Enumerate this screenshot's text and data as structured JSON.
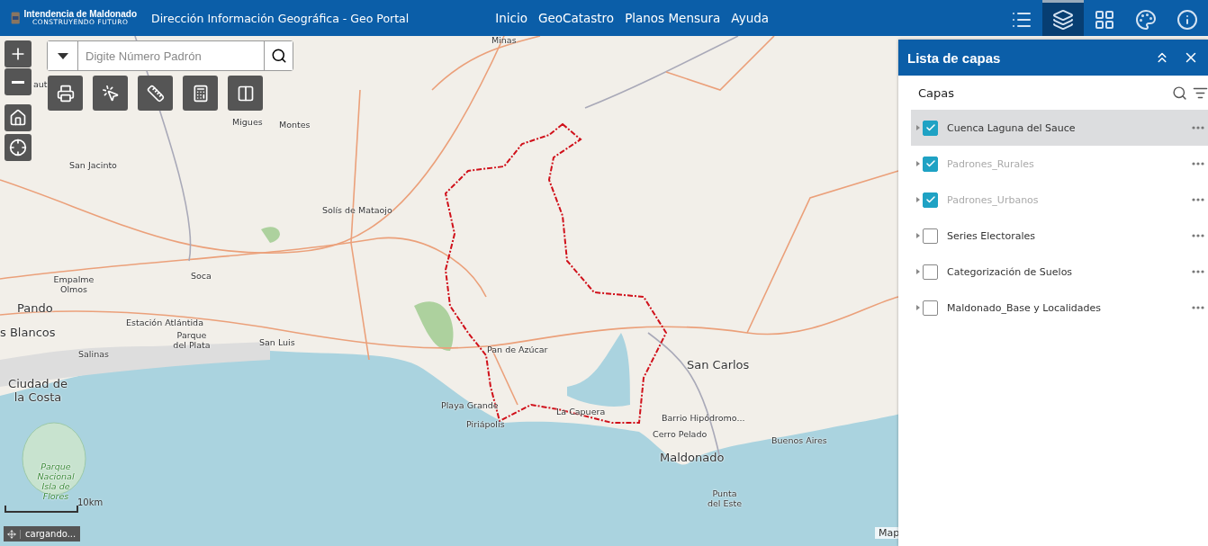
{
  "header": {
    "logo_title": "Intendencia de Maldonado",
    "logo_subtitle": "CONSTRUYENDO FUTURO",
    "title": "Dirección Información Geográfica -  Geo Portal",
    "nav": [
      "Inicio",
      "GeoCatastro",
      "Planos Mensura",
      "Ayuda"
    ],
    "tools": [
      {
        "kind": "legend",
        "selected": false
      },
      {
        "kind": "layers",
        "selected": true
      },
      {
        "kind": "grid",
        "selected": false
      },
      {
        "kind": "palette",
        "selected": false
      },
      {
        "kind": "info",
        "selected": false
      }
    ]
  },
  "search": {
    "placeholder": "Digite Número Padrón"
  },
  "map_labels": [
    {
      "text": "Minas",
      "kind": "town"
    },
    {
      "text": "aut",
      "kind": "town"
    },
    {
      "text": "Migues",
      "kind": "town"
    },
    {
      "text": "Montes",
      "kind": "town"
    },
    {
      "text": "San Jacinto",
      "kind": "town"
    },
    {
      "text": "Solís de Mataojo",
      "kind": "town"
    },
    {
      "text": "Empalme Olmos",
      "kind": "town"
    },
    {
      "text": "Soca",
      "kind": "town"
    },
    {
      "text": "Pando",
      "kind": "city"
    },
    {
      "text": "Estación Atlántida",
      "kind": "town"
    },
    {
      "text": "Parque del Plata",
      "kind": "town"
    },
    {
      "text": "San Luis",
      "kind": "town"
    },
    {
      "text": "s Blancos",
      "kind": "city"
    },
    {
      "text": "Salinas",
      "kind": "town"
    },
    {
      "text": "Ciudad de la Costa",
      "kind": "city"
    },
    {
      "text": "Pan de Azúcar",
      "kind": "town"
    },
    {
      "text": "San Carlos",
      "kind": "city"
    },
    {
      "text": "Playa Grande",
      "kind": "town"
    },
    {
      "text": "Piriápolis",
      "kind": "town"
    },
    {
      "text": "La Capuera",
      "kind": "town"
    },
    {
      "text": "Barrio Hipódromo...",
      "kind": "town"
    },
    {
      "text": "Cerro Pelado",
      "kind": "town"
    },
    {
      "text": "Maldonado",
      "kind": "city"
    },
    {
      "text": "Buenos Aires",
      "kind": "town"
    },
    {
      "text": "Punta del Este",
      "kind": "town"
    },
    {
      "text": "Parque Nacional Isla de Flores",
      "kind": "park"
    }
  ],
  "scale": "10km",
  "status": "cargando...",
  "attribution": "Map",
  "panel": {
    "title": "Lista de capas",
    "section": "Capas",
    "layers": [
      {
        "label": "Cuenca Laguna del Sauce",
        "checked": true,
        "disabled": false,
        "selected": true
      },
      {
        "label": "Padrones_Rurales",
        "checked": true,
        "disabled": true,
        "selected": false
      },
      {
        "label": "Padrones_Urbanos",
        "checked": true,
        "disabled": true,
        "selected": false
      },
      {
        "label": "Series Electorales",
        "checked": false,
        "disabled": false,
        "selected": false
      },
      {
        "label": "Categorización de Suelos",
        "checked": false,
        "disabled": false,
        "selected": false
      },
      {
        "label": "Maldonado_Base y Localidades",
        "checked": false,
        "disabled": false,
        "selected": false
      }
    ]
  }
}
